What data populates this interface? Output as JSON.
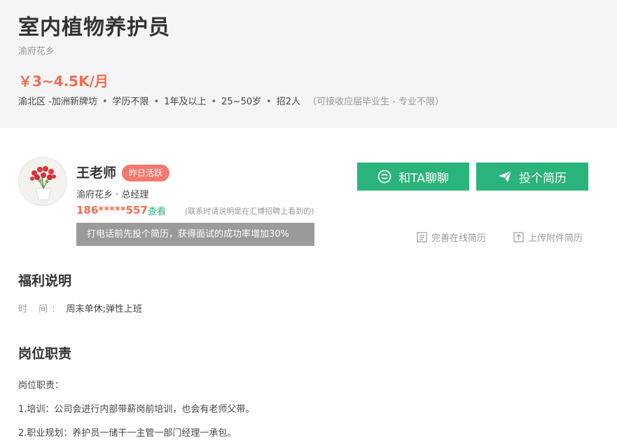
{
  "job": {
    "title": "室内植物养护员",
    "company": "渝府花乡",
    "salary": "￥3~4.5K/月",
    "meta": {
      "location": "渝北区 -加洲新牌坊",
      "education": "学历不限",
      "experience": "1年及以上",
      "age": "25~50岁",
      "hiring": "招2人",
      "note": "（可接收应届毕业生 - 专业不限）"
    }
  },
  "recruiter": {
    "name": "王老师",
    "active_badge": "昨日活跃",
    "role": "渝府花乡 · 总经理",
    "phone": "186*****557",
    "view_label": "查看",
    "contact_note": "(联系时请说明是在汇博招聘上看到的)",
    "tooltip": "打电话前先投个简历，获得面试的成功率增加30%"
  },
  "actions": {
    "chat_label": "和TA聊聊",
    "apply_label": "投个简历",
    "complete_online_label": "完善在线简历",
    "upload_label": "上传附件简历"
  },
  "benefits": {
    "title": "福利说明",
    "time_key": "时 间:",
    "time_value": "周末单休;弹性上班"
  },
  "duties": {
    "title": "岗位职责",
    "lines": [
      "岗位职责：",
      "1.培训：公司会进行内部带薪岗前培训，也会有老师父带。",
      "2.职业规划：养护员一储干一主管一部门经理一承包。"
    ]
  },
  "colors": {
    "accent_green": "#2ab37a",
    "salary_orange": "#f26d4f",
    "badge_red": "#f3786e"
  }
}
